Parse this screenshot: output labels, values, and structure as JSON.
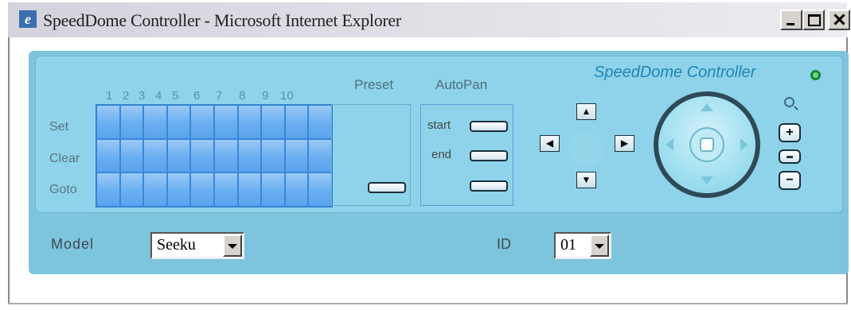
{
  "window": {
    "title": "SpeedDome Controller - Microsoft Internet Explorer"
  },
  "panel": {
    "brand": "SpeedDome Controller",
    "numbers": [
      "1",
      "2",
      "3",
      "4",
      "5",
      "6",
      "7",
      "8",
      "9",
      "10"
    ],
    "row_labels": [
      "Set",
      "Clear",
      "Goto"
    ],
    "preset_label": "Preset",
    "autopan_label": "AutoPan",
    "autopan_start": "start",
    "autopan_end": "end",
    "zoom_in": "+",
    "zoom_out": "−"
  },
  "bottom": {
    "model_label": "Model",
    "model_value": "Seeku",
    "id_label": "ID",
    "id_value": "01"
  }
}
